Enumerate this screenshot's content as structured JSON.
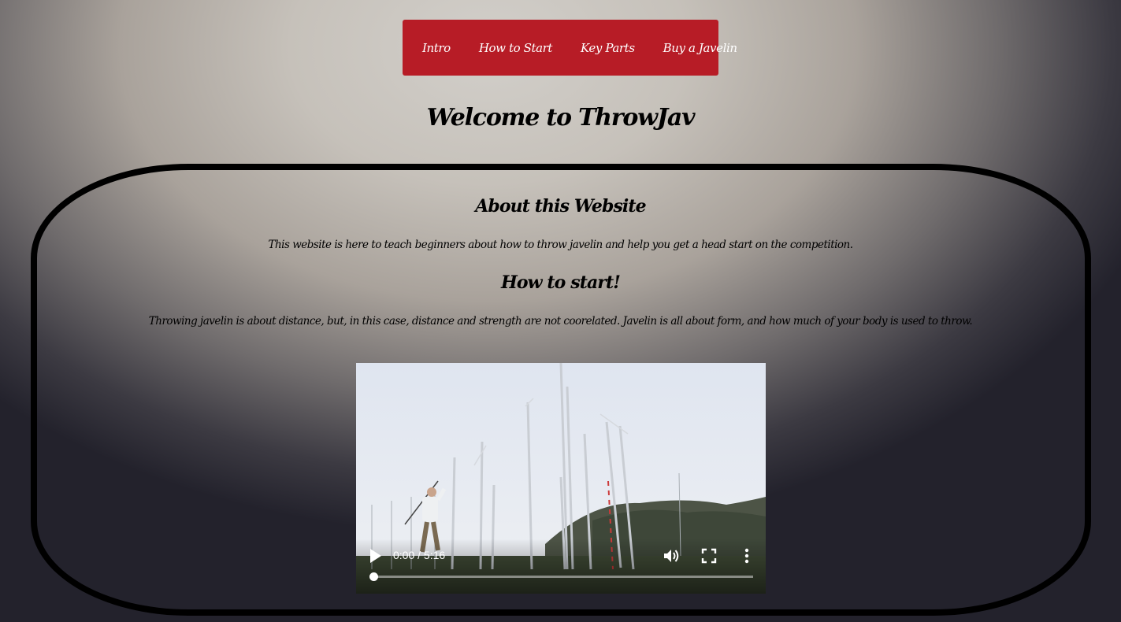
{
  "nav": {
    "items": [
      {
        "label": "Intro"
      },
      {
        "label": "How to Start"
      },
      {
        "label": "Key Parts"
      },
      {
        "label": "Buy a Javelin"
      }
    ]
  },
  "header": {
    "title": "Welcome to ThrowJav"
  },
  "about": {
    "heading": "About this Website",
    "text": "This website is here to teach beginners about how to throw javelin and help you get a head start on the competition."
  },
  "how_to_start": {
    "heading": "How to start!",
    "text": "Throwing javelin is about distance, but, in this case, distance and strength are not coorelated. Javelin is all about form, and how much of your body is used to throw."
  },
  "video": {
    "time_display": "0:00 / 5:16",
    "progress": 0,
    "icons": [
      "play-icon",
      "volume-icon",
      "fullscreen-icon",
      "more-options-icon"
    ]
  },
  "colors": {
    "nav_background": "#b71c26",
    "nav_text": "#ffffff",
    "frame_border": "#000000"
  }
}
